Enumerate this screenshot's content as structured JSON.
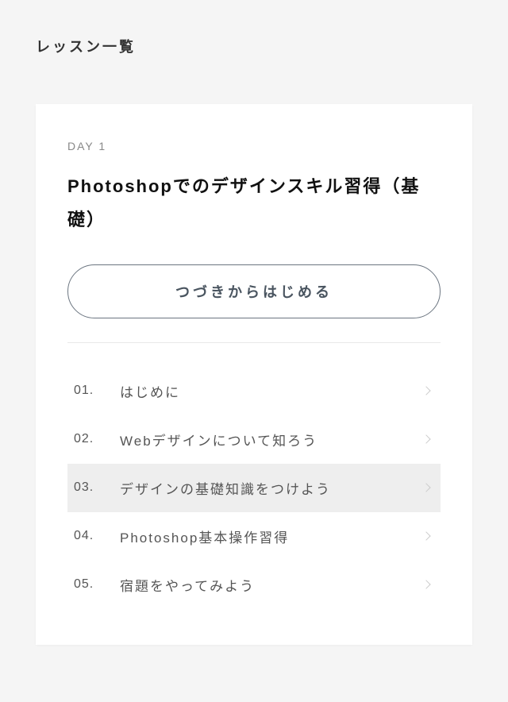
{
  "page_title": "レッスン一覧",
  "card": {
    "day_label": "DAY 1",
    "course_title": "Photoshopでのデザインスキル習得（基礎）",
    "continue_label": "つづきからはじめる"
  },
  "lessons": [
    {
      "number": "01.",
      "title": "はじめに",
      "highlighted": false
    },
    {
      "number": "02.",
      "title": "Webデザインについて知ろう",
      "highlighted": false
    },
    {
      "number": "03.",
      "title": "デザインの基礎知識をつけよう",
      "highlighted": true
    },
    {
      "number": "04.",
      "title": "Photoshop基本操作習得",
      "highlighted": false
    },
    {
      "number": "05.",
      "title": "宿題をやってみよう",
      "highlighted": false
    }
  ]
}
